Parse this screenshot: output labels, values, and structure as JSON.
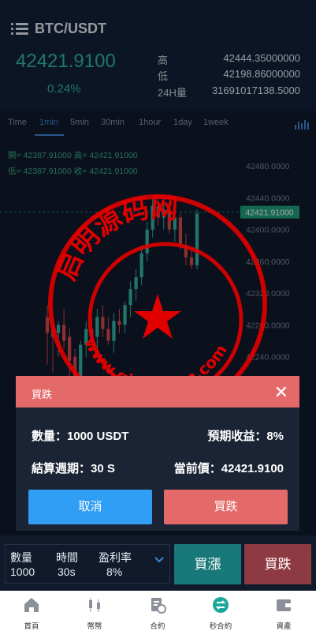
{
  "header": {
    "title": "BTC/USDT",
    "price": "42421.9100",
    "change_pct": "0.24%",
    "stats": [
      {
        "label": "高",
        "value": "42444.35000000"
      },
      {
        "label": "低",
        "value": "42198.86000000"
      },
      {
        "label": "24H量",
        "value": "31691017138.5000"
      }
    ]
  },
  "tabs": [
    "Time",
    "1min",
    "5min",
    "30min",
    "1hour",
    "1day",
    "1week"
  ],
  "active_tab": "1min",
  "chart": {
    "ohlc_line1": "開= 42387.91000  高= 42421.91000",
    "ohlc_line2": "低= 42387.91000  收= 42421.91000",
    "y_labels": [
      "42480.0000",
      "42440.0000",
      "42400.0000",
      "42360.0000",
      "42320.0000",
      "42280.0000",
      "42240.0000"
    ],
    "current_label": "42421.91000",
    "colors": {
      "up": "#33b6a6",
      "down": "#d94b4b",
      "bg": "#101a2b"
    }
  },
  "chart_data": {
    "type": "candlestick",
    "ylim": [
      42200,
      42500
    ],
    "candles": [
      {
        "o": 42290,
        "h": 42305,
        "l": 42230,
        "c": 42270
      },
      {
        "o": 42275,
        "h": 42290,
        "l": 42220,
        "c": 42265
      },
      {
        "o": 42270,
        "h": 42285,
        "l": 42240,
        "c": 42280
      },
      {
        "o": 42280,
        "h": 42300,
        "l": 42250,
        "c": 42260
      },
      {
        "o": 42265,
        "h": 42275,
        "l": 42215,
        "c": 42235
      },
      {
        "o": 42240,
        "h": 42250,
        "l": 42200,
        "c": 42215
      },
      {
        "o": 42215,
        "h": 42260,
        "l": 42205,
        "c": 42255
      },
      {
        "o": 42255,
        "h": 42285,
        "l": 42240,
        "c": 42275
      },
      {
        "o": 42275,
        "h": 42290,
        "l": 42255,
        "c": 42265
      },
      {
        "o": 42265,
        "h": 42300,
        "l": 42250,
        "c": 42290
      },
      {
        "o": 42290,
        "h": 42305,
        "l": 42265,
        "c": 42275
      },
      {
        "o": 42275,
        "h": 42290,
        "l": 42255,
        "c": 42260
      },
      {
        "o": 42260,
        "h": 42295,
        "l": 42245,
        "c": 42285
      },
      {
        "o": 42285,
        "h": 42300,
        "l": 42270,
        "c": 42280
      },
      {
        "o": 42280,
        "h": 42310,
        "l": 42270,
        "c": 42305
      },
      {
        "o": 42305,
        "h": 42335,
        "l": 42290,
        "c": 42325
      },
      {
        "o": 42325,
        "h": 42350,
        "l": 42310,
        "c": 42340
      },
      {
        "o": 42340,
        "h": 42380,
        "l": 42330,
        "c": 42370
      },
      {
        "o": 42370,
        "h": 42410,
        "l": 42360,
        "c": 42400
      },
      {
        "o": 42400,
        "h": 42440,
        "l": 42390,
        "c": 42430
      },
      {
        "o": 42430,
        "h": 42445,
        "l": 42405,
        "c": 42415
      },
      {
        "o": 42415,
        "h": 42440,
        "l": 42400,
        "c": 42425
      },
      {
        "o": 42425,
        "h": 42445,
        "l": 42395,
        "c": 42400
      },
      {
        "o": 42400,
        "h": 42425,
        "l": 42385,
        "c": 42415
      },
      {
        "o": 42415,
        "h": 42420,
        "l": 42375,
        "c": 42380
      },
      {
        "o": 42380,
        "h": 42395,
        "l": 42355,
        "c": 42365
      },
      {
        "o": 42365,
        "h": 42375,
        "l": 42350,
        "c": 42355
      },
      {
        "o": 42355,
        "h": 42425,
        "l": 42350,
        "c": 42420
      }
    ]
  },
  "modal": {
    "title": "買跌",
    "close_glyph": "✕",
    "qty": "數量：1000 USDT",
    "profit": "預期收益：8%",
    "period": "結算週期：30 S",
    "cur_price": "當前價：42421.9100",
    "cancel_label": "取消",
    "confirm_label": "買跌"
  },
  "trade": {
    "qty_label": "數量",
    "qty_value": "1000",
    "time_label": "時間",
    "time_value": "30s",
    "profit_label": "盈利率",
    "profit_value": "8%",
    "up_label": "買漲",
    "down_label": "買跌"
  },
  "nav": [
    {
      "label": "首頁",
      "icon": "home-icon"
    },
    {
      "label": "幣幣",
      "icon": "candles-icon"
    },
    {
      "label": "合約",
      "icon": "contract-icon"
    },
    {
      "label": "秒合約",
      "icon": "swap-icon"
    },
    {
      "label": "資產",
      "icon": "wallet-icon"
    }
  ],
  "watermark": {
    "text": "启明源码网",
    "url": "www.qimingym.com"
  }
}
